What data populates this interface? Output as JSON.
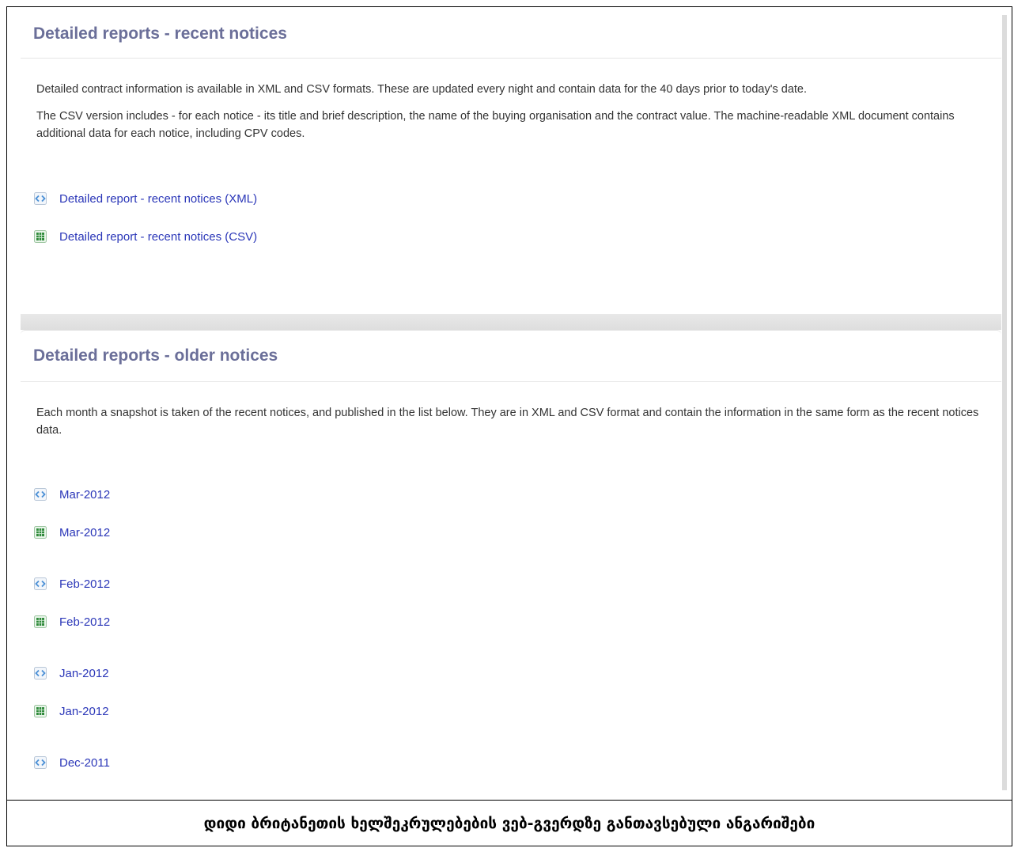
{
  "recent": {
    "heading": "Detailed reports - recent notices",
    "paragraphs": [
      "Detailed contract information is available in XML and CSV formats. These are updated every night and contain data for the 40 days prior to today's date.",
      "The CSV version includes - for each notice - its title and brief description, the name of the buying organisation and the contract value. The machine-readable XML document contains additional data for each notice, including CPV codes."
    ],
    "links": [
      {
        "label": "Detailed report - recent notices (XML)",
        "icon": "xml-file-icon"
      },
      {
        "label": "Detailed report - recent notices (CSV)",
        "icon": "csv-spreadsheet-icon"
      }
    ]
  },
  "older": {
    "heading": "Detailed reports - older notices",
    "paragraph": "Each month a snapshot is taken of the recent notices, and published in the list below.  They are in XML and CSV format and contain the information in the same form as the recent notices data.",
    "links": [
      {
        "label": "Mar-2012",
        "icon": "xml-file-icon"
      },
      {
        "label": "Mar-2012",
        "icon": "csv-spreadsheet-icon"
      },
      {
        "label": "Feb-2012",
        "icon": "xml-file-icon"
      },
      {
        "label": "Feb-2012",
        "icon": "csv-spreadsheet-icon"
      },
      {
        "label": "Jan-2012",
        "icon": "xml-file-icon"
      },
      {
        "label": "Jan-2012",
        "icon": "csv-spreadsheet-icon"
      },
      {
        "label": "Dec-2011",
        "icon": "xml-file-icon"
      }
    ]
  },
  "caption": "დიდი ბრიტანეთის ხელშეკრულებების ვებ-გვერდზე განთავსებული ანგარიშები",
  "colors": {
    "heading": "#6b6f99",
    "link": "#2a36b8",
    "body_text": "#333333",
    "xml_icon": "#4a8fd6",
    "csv_icon": "#2f8a3a"
  }
}
